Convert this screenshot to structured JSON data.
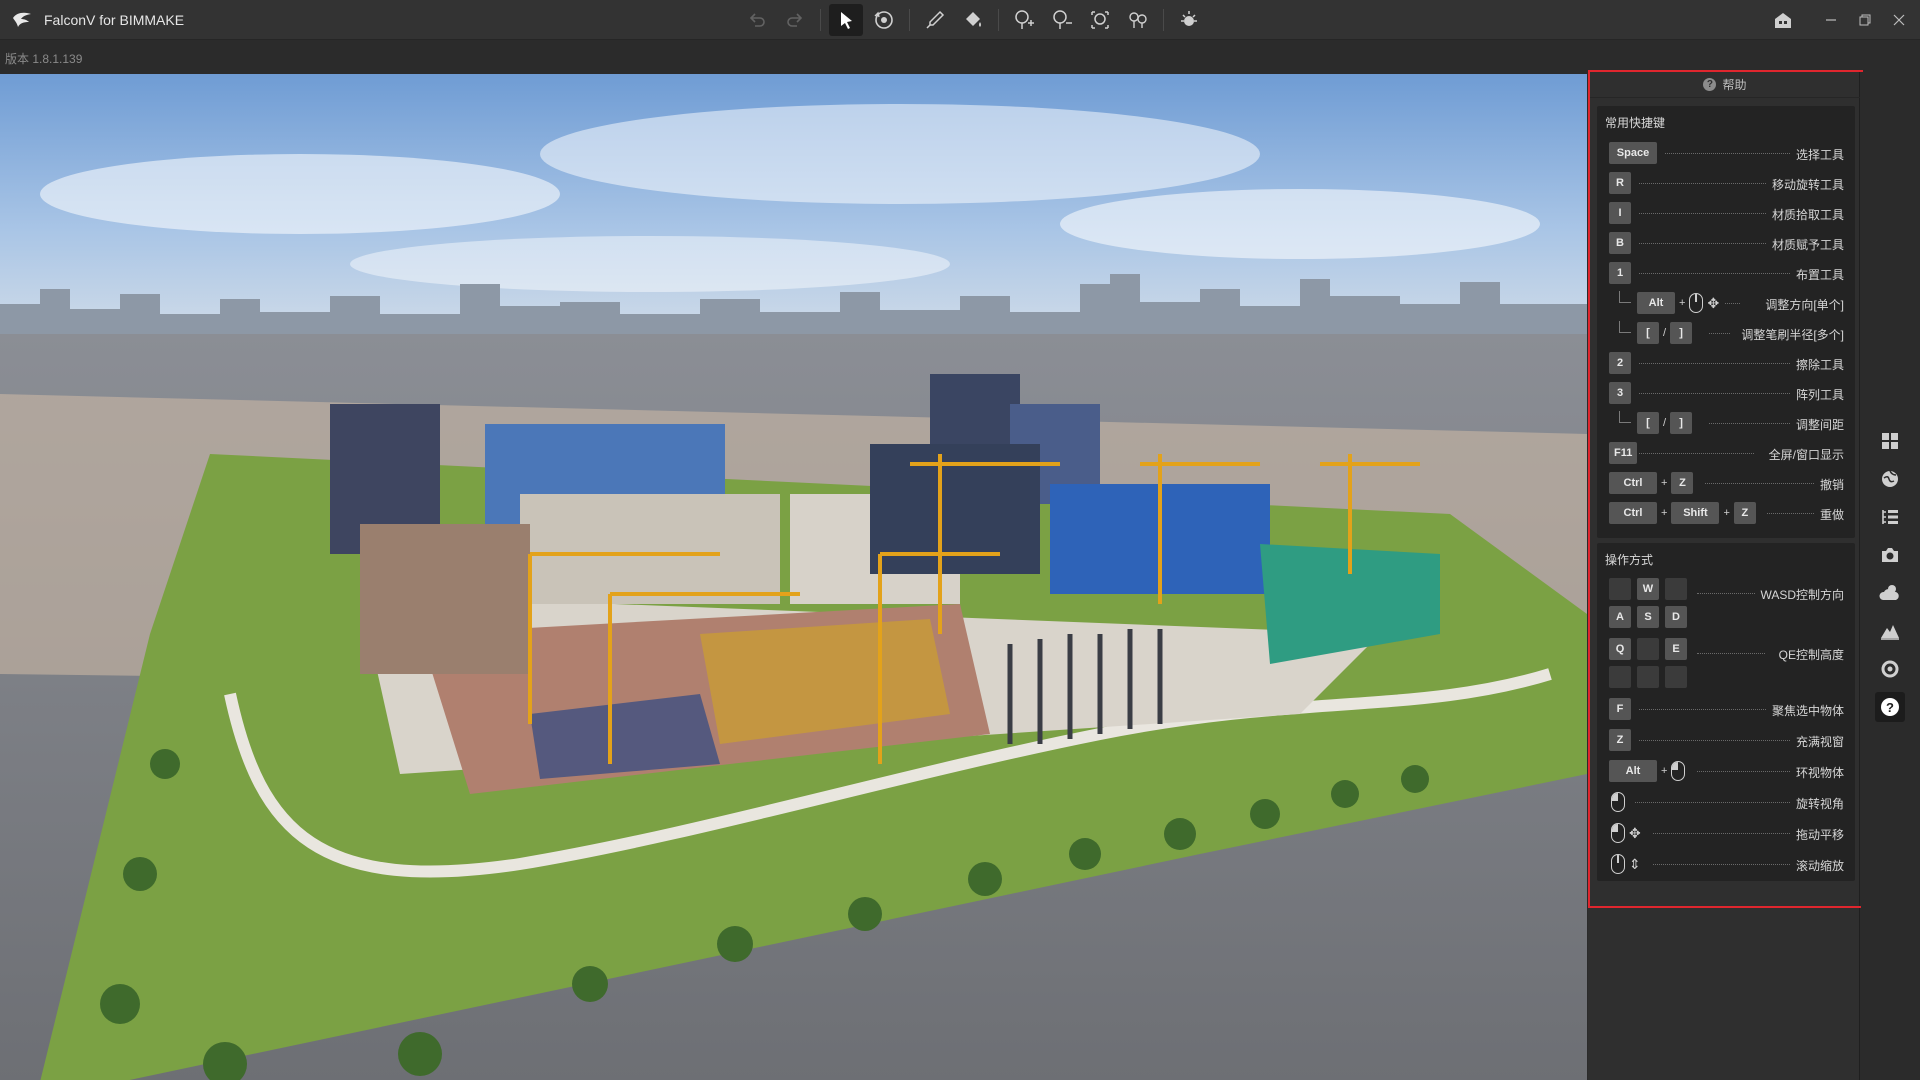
{
  "app": {
    "title": "FalconV for BIMMAKE",
    "version": "版本 1.8.1.139"
  },
  "toolbar": {
    "undo": "undo-icon",
    "redo": "redo-icon",
    "select": "cursor-icon",
    "orbit": "orbit-icon",
    "brush": "brush-icon",
    "fill": "paint-bucket-icon",
    "place": "place-tree-icon",
    "erase": "erase-tree-icon",
    "array": "array-icon",
    "scatter": "scatter-icon",
    "weather": "sun-icon"
  },
  "help": {
    "title": "帮助",
    "shortcuts_title": "常用快捷键",
    "shortcuts": [
      {
        "keys": [
          "Space"
        ],
        "label": "选择工具"
      },
      {
        "keys": [
          "R"
        ],
        "label": "移动旋转工具"
      },
      {
        "keys": [
          "I"
        ],
        "label": "材质拾取工具"
      },
      {
        "keys": [
          "B"
        ],
        "label": "材质赋予工具"
      },
      {
        "keys": [
          "1"
        ],
        "label": "布置工具"
      },
      {
        "keys": [
          "Alt"
        ],
        "label": "调整方向[单个]"
      },
      {
        "keys": [
          "[",
          "]"
        ],
        "sep": "/",
        "label": "调整笔刷半径[多个]"
      },
      {
        "keys": [
          "2"
        ],
        "label": "擦除工具"
      },
      {
        "keys": [
          "3"
        ],
        "label": "阵列工具"
      },
      {
        "keys": [
          "[",
          "]"
        ],
        "sep": "/",
        "label": "调整间距"
      },
      {
        "keys": [
          "F11"
        ],
        "label": "全屏/窗口显示"
      },
      {
        "keys": [
          "Ctrl",
          "Z"
        ],
        "sep": "+",
        "label": "撤销"
      },
      {
        "keys": [
          "Ctrl",
          "Shift",
          "Z"
        ],
        "sep": "+",
        "label": "重做"
      }
    ],
    "operations_title": "操作方式",
    "operations": [
      {
        "keys": [
          "W",
          "A",
          "S",
          "D"
        ],
        "label": "WASD控制方向"
      },
      {
        "keys": [
          "Q",
          "E"
        ],
        "label": "QE控制高度"
      },
      {
        "keys": [
          "F"
        ],
        "label": "聚焦选中物体"
      },
      {
        "keys": [
          "Z"
        ],
        "label": "充满视窗"
      },
      {
        "keys": [
          "Alt"
        ],
        "label": "环视物体"
      },
      {
        "keys": [],
        "label": "旋转视角"
      },
      {
        "keys": [],
        "label": "拖动平移"
      },
      {
        "keys": [],
        "label": "滚动缩放"
      }
    ]
  },
  "rail": [
    "grid-icon",
    "globe-icon",
    "list-icon",
    "camera-icon",
    "weather-icon",
    "terrain-icon",
    "settings-icon",
    "help-icon"
  ],
  "colors": {
    "accent_red": "#e0262e",
    "panel_bg": "#232323",
    "key_bg": "#555555"
  }
}
